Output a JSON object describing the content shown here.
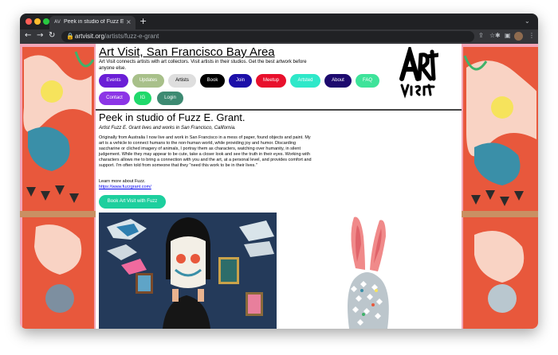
{
  "browser": {
    "tab_title": "Peek in studio of Fuzz E. Grant",
    "tab_favicon": "AV",
    "new_tab": "+",
    "tab_close": "×",
    "tab_menu": "⌄",
    "url_host": "artvisit.org",
    "url_path": "/artists/fuzz-e-grant",
    "icons": {
      "back": "←",
      "forward": "→",
      "reload": "↻",
      "lock": "🔒",
      "share": "⇪",
      "bookmark": "☆",
      "extensions": "✱",
      "sidebar": "▣",
      "menu": "⋮"
    }
  },
  "site": {
    "title": "Art Visit, San Francisco Bay Area",
    "tagline": "Art Visit connects artists with art collectors. Visit artists in their studios. Get the best artwork before anyone else.",
    "nav": [
      {
        "label": "Events",
        "color": "#6a1ed6"
      },
      {
        "label": "Updates",
        "color": "#a8c08a"
      },
      {
        "label": "Artists",
        "color": "#dedede",
        "text_color": "#000000"
      },
      {
        "label": "Book",
        "color": "#000000"
      },
      {
        "label": "Join",
        "color": "#1c0fa8"
      },
      {
        "label": "Meetup",
        "color": "#e8102c"
      },
      {
        "label": "Artsted",
        "color": "#2ee8c9"
      },
      {
        "label": "About",
        "color": "#1d0a6e"
      },
      {
        "label": "FAQ",
        "color": "#3ee39a"
      },
      {
        "label": "Contact",
        "color": "#8c35e6"
      },
      {
        "label": "IG",
        "color": "#20d96b"
      },
      {
        "label": "Login",
        "color": "#3d8a72"
      }
    ]
  },
  "artist": {
    "heading": "Peek in studio of Fuzz E. Grant.",
    "subtitle": "Artist Fuzz E. Grant lives and works in San Francisco, California.",
    "bio": "Originally from Australia I now live and work in San Francisco in a mess of paper, found objects and paint. My art is a vehicle to connect humans to the non-human world, while providing joy and humor. Discarding saccharine or cliched imagery of animals, I portray them as characters, watching over humanity, in silent judgement. While they may appear to be cute, take a closer look and see the truth in their eyes. Working with characters allows me to bring a connection with you and the art, at a personal level, and provides comfort and support. I'm often told from someone that they \"need this work to be in their lives.\"",
    "learn_more": "Learn more about Fuzz.",
    "website": "https://www.fuzzgrant.com/",
    "book_button": "Book Art Visit with Fuzz"
  },
  "colors": {
    "tabbar": "#202124",
    "toolbar": "#35363a",
    "wallpaper_pink": "#f3a6b8",
    "book_button": "#1dcf9e"
  }
}
